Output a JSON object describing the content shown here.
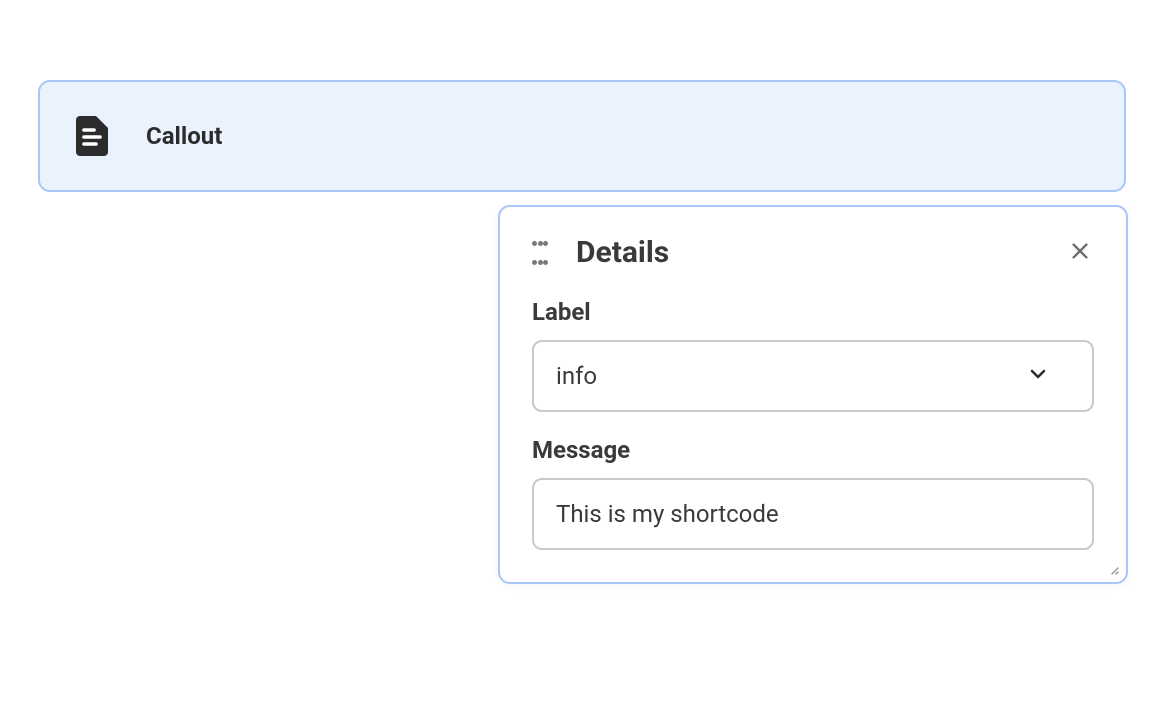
{
  "callout": {
    "title": "Callout"
  },
  "details": {
    "title": "Details",
    "fields": {
      "label": {
        "label": "Label",
        "value": "info"
      },
      "message": {
        "label": "Message",
        "value": "This is my shortcode"
      }
    }
  }
}
